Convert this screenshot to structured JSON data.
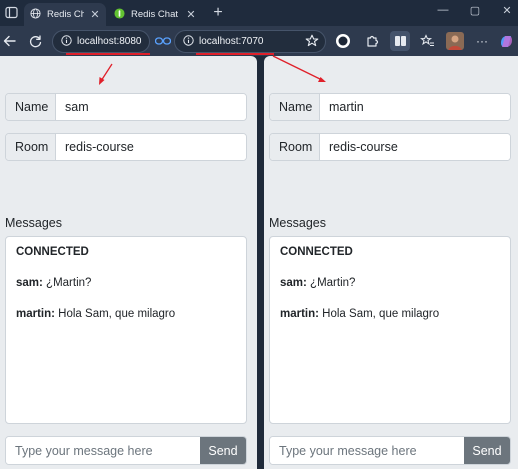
{
  "browser": {
    "tabs": [
      {
        "title": "Redis Chat D",
        "icon": "globe-icon",
        "active": true
      },
      {
        "title": "Redis Chat",
        "icon": "green-favicon-icon",
        "active": false
      }
    ],
    "new_tab": "+",
    "window_controls": {
      "minimize": "—",
      "maximize": "▢",
      "close": "✕"
    },
    "address_left": "localhost:8080",
    "address_right": "localhost:7070",
    "annotation_color": "#e0202a"
  },
  "left_pane": {
    "name_label": "Name",
    "name_value": "sam",
    "room_label": "Room",
    "room_value": "redis-course",
    "messages_label": "Messages",
    "messages": [
      {
        "user": "",
        "text": "CONNECTED"
      },
      {
        "user": "sam:",
        "text": " ¿Martin?"
      },
      {
        "user": "martin:",
        "text": " Hola Sam, que milagro"
      }
    ],
    "input_placeholder": "Type your message here",
    "send_label": "Send"
  },
  "right_pane": {
    "name_label": "Name",
    "name_value": "martin",
    "room_label": "Room",
    "room_value": "redis-course",
    "messages_label": "Messages",
    "messages": [
      {
        "user": "",
        "text": "CONNECTED"
      },
      {
        "user": "sam:",
        "text": " ¿Martin?"
      },
      {
        "user": "martin:",
        "text": " Hola Sam, que milagro"
      }
    ],
    "input_placeholder": "Type your message here",
    "send_label": "Send"
  }
}
